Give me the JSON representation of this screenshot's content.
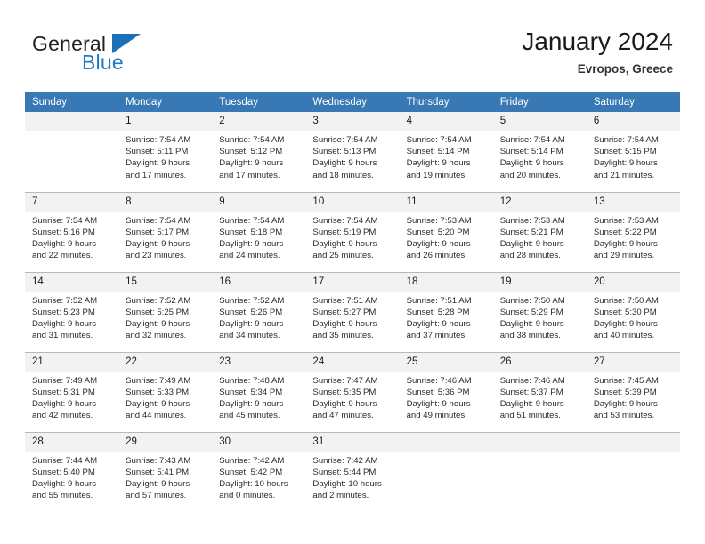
{
  "brand": {
    "name_part1": "General",
    "name_part2": "Blue",
    "triangle_color": "#1d6fb8"
  },
  "header": {
    "title": "January 2024",
    "location": "Evropos, Greece"
  },
  "theme": {
    "header_row_bg": "#3878b4",
    "daynum_bg": "#f2f2f2",
    "grid_line": "#b8b8b8"
  },
  "weekdays": [
    "Sunday",
    "Monday",
    "Tuesday",
    "Wednesday",
    "Thursday",
    "Friday",
    "Saturday"
  ],
  "weeks": [
    [
      {
        "day": "",
        "sunrise": "",
        "sunset": "",
        "daylight1": "",
        "daylight2": ""
      },
      {
        "day": "1",
        "sunrise": "Sunrise: 7:54 AM",
        "sunset": "Sunset: 5:11 PM",
        "daylight1": "Daylight: 9 hours",
        "daylight2": "and 17 minutes."
      },
      {
        "day": "2",
        "sunrise": "Sunrise: 7:54 AM",
        "sunset": "Sunset: 5:12 PM",
        "daylight1": "Daylight: 9 hours",
        "daylight2": "and 17 minutes."
      },
      {
        "day": "3",
        "sunrise": "Sunrise: 7:54 AM",
        "sunset": "Sunset: 5:13 PM",
        "daylight1": "Daylight: 9 hours",
        "daylight2": "and 18 minutes."
      },
      {
        "day": "4",
        "sunrise": "Sunrise: 7:54 AM",
        "sunset": "Sunset: 5:14 PM",
        "daylight1": "Daylight: 9 hours",
        "daylight2": "and 19 minutes."
      },
      {
        "day": "5",
        "sunrise": "Sunrise: 7:54 AM",
        "sunset": "Sunset: 5:14 PM",
        "daylight1": "Daylight: 9 hours",
        "daylight2": "and 20 minutes."
      },
      {
        "day": "6",
        "sunrise": "Sunrise: 7:54 AM",
        "sunset": "Sunset: 5:15 PM",
        "daylight1": "Daylight: 9 hours",
        "daylight2": "and 21 minutes."
      }
    ],
    [
      {
        "day": "7",
        "sunrise": "Sunrise: 7:54 AM",
        "sunset": "Sunset: 5:16 PM",
        "daylight1": "Daylight: 9 hours",
        "daylight2": "and 22 minutes."
      },
      {
        "day": "8",
        "sunrise": "Sunrise: 7:54 AM",
        "sunset": "Sunset: 5:17 PM",
        "daylight1": "Daylight: 9 hours",
        "daylight2": "and 23 minutes."
      },
      {
        "day": "9",
        "sunrise": "Sunrise: 7:54 AM",
        "sunset": "Sunset: 5:18 PM",
        "daylight1": "Daylight: 9 hours",
        "daylight2": "and 24 minutes."
      },
      {
        "day": "10",
        "sunrise": "Sunrise: 7:54 AM",
        "sunset": "Sunset: 5:19 PM",
        "daylight1": "Daylight: 9 hours",
        "daylight2": "and 25 minutes."
      },
      {
        "day": "11",
        "sunrise": "Sunrise: 7:53 AM",
        "sunset": "Sunset: 5:20 PM",
        "daylight1": "Daylight: 9 hours",
        "daylight2": "and 26 minutes."
      },
      {
        "day": "12",
        "sunrise": "Sunrise: 7:53 AM",
        "sunset": "Sunset: 5:21 PM",
        "daylight1": "Daylight: 9 hours",
        "daylight2": "and 28 minutes."
      },
      {
        "day": "13",
        "sunrise": "Sunrise: 7:53 AM",
        "sunset": "Sunset: 5:22 PM",
        "daylight1": "Daylight: 9 hours",
        "daylight2": "and 29 minutes."
      }
    ],
    [
      {
        "day": "14",
        "sunrise": "Sunrise: 7:52 AM",
        "sunset": "Sunset: 5:23 PM",
        "daylight1": "Daylight: 9 hours",
        "daylight2": "and 31 minutes."
      },
      {
        "day": "15",
        "sunrise": "Sunrise: 7:52 AM",
        "sunset": "Sunset: 5:25 PM",
        "daylight1": "Daylight: 9 hours",
        "daylight2": "and 32 minutes."
      },
      {
        "day": "16",
        "sunrise": "Sunrise: 7:52 AM",
        "sunset": "Sunset: 5:26 PM",
        "daylight1": "Daylight: 9 hours",
        "daylight2": "and 34 minutes."
      },
      {
        "day": "17",
        "sunrise": "Sunrise: 7:51 AM",
        "sunset": "Sunset: 5:27 PM",
        "daylight1": "Daylight: 9 hours",
        "daylight2": "and 35 minutes."
      },
      {
        "day": "18",
        "sunrise": "Sunrise: 7:51 AM",
        "sunset": "Sunset: 5:28 PM",
        "daylight1": "Daylight: 9 hours",
        "daylight2": "and 37 minutes."
      },
      {
        "day": "19",
        "sunrise": "Sunrise: 7:50 AM",
        "sunset": "Sunset: 5:29 PM",
        "daylight1": "Daylight: 9 hours",
        "daylight2": "and 38 minutes."
      },
      {
        "day": "20",
        "sunrise": "Sunrise: 7:50 AM",
        "sunset": "Sunset: 5:30 PM",
        "daylight1": "Daylight: 9 hours",
        "daylight2": "and 40 minutes."
      }
    ],
    [
      {
        "day": "21",
        "sunrise": "Sunrise: 7:49 AM",
        "sunset": "Sunset: 5:31 PM",
        "daylight1": "Daylight: 9 hours",
        "daylight2": "and 42 minutes."
      },
      {
        "day": "22",
        "sunrise": "Sunrise: 7:49 AM",
        "sunset": "Sunset: 5:33 PM",
        "daylight1": "Daylight: 9 hours",
        "daylight2": "and 44 minutes."
      },
      {
        "day": "23",
        "sunrise": "Sunrise: 7:48 AM",
        "sunset": "Sunset: 5:34 PM",
        "daylight1": "Daylight: 9 hours",
        "daylight2": "and 45 minutes."
      },
      {
        "day": "24",
        "sunrise": "Sunrise: 7:47 AM",
        "sunset": "Sunset: 5:35 PM",
        "daylight1": "Daylight: 9 hours",
        "daylight2": "and 47 minutes."
      },
      {
        "day": "25",
        "sunrise": "Sunrise: 7:46 AM",
        "sunset": "Sunset: 5:36 PM",
        "daylight1": "Daylight: 9 hours",
        "daylight2": "and 49 minutes."
      },
      {
        "day": "26",
        "sunrise": "Sunrise: 7:46 AM",
        "sunset": "Sunset: 5:37 PM",
        "daylight1": "Daylight: 9 hours",
        "daylight2": "and 51 minutes."
      },
      {
        "day": "27",
        "sunrise": "Sunrise: 7:45 AM",
        "sunset": "Sunset: 5:39 PM",
        "daylight1": "Daylight: 9 hours",
        "daylight2": "and 53 minutes."
      }
    ],
    [
      {
        "day": "28",
        "sunrise": "Sunrise: 7:44 AM",
        "sunset": "Sunset: 5:40 PM",
        "daylight1": "Daylight: 9 hours",
        "daylight2": "and 55 minutes."
      },
      {
        "day": "29",
        "sunrise": "Sunrise: 7:43 AM",
        "sunset": "Sunset: 5:41 PM",
        "daylight1": "Daylight: 9 hours",
        "daylight2": "and 57 minutes."
      },
      {
        "day": "30",
        "sunrise": "Sunrise: 7:42 AM",
        "sunset": "Sunset: 5:42 PM",
        "daylight1": "Daylight: 10 hours",
        "daylight2": "and 0 minutes."
      },
      {
        "day": "31",
        "sunrise": "Sunrise: 7:42 AM",
        "sunset": "Sunset: 5:44 PM",
        "daylight1": "Daylight: 10 hours",
        "daylight2": "and 2 minutes."
      },
      {
        "day": "",
        "sunrise": "",
        "sunset": "",
        "daylight1": "",
        "daylight2": ""
      },
      {
        "day": "",
        "sunrise": "",
        "sunset": "",
        "daylight1": "",
        "daylight2": ""
      },
      {
        "day": "",
        "sunrise": "",
        "sunset": "",
        "daylight1": "",
        "daylight2": ""
      }
    ]
  ]
}
